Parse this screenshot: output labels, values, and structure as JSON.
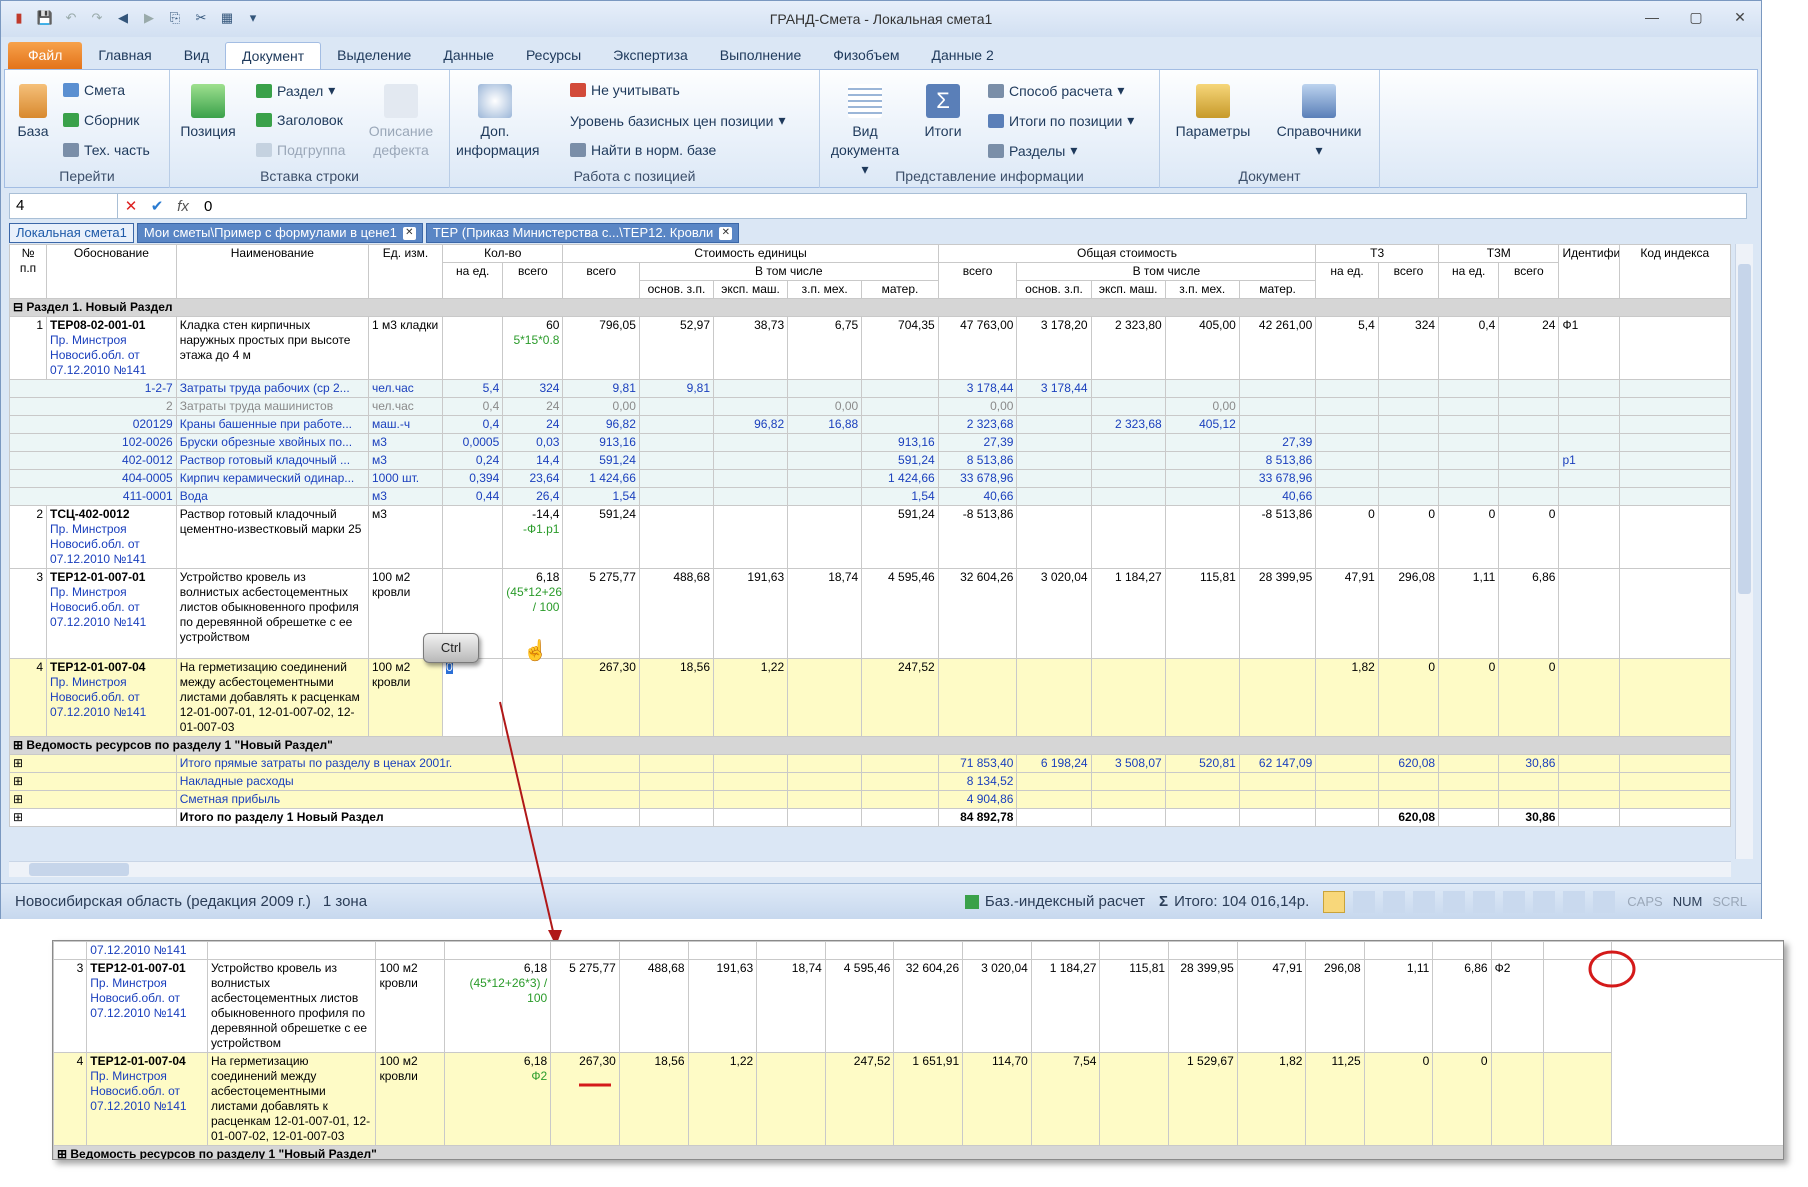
{
  "app": {
    "title": "ГРАНД-Смета - Локальная смета1"
  },
  "tabs": [
    "Файл",
    "Главная",
    "Вид",
    "Документ",
    "Выделение",
    "Данные",
    "Ресурсы",
    "Экспертиза",
    "Выполнение",
    "Физобъем",
    "Данные 2"
  ],
  "ribbon": {
    "base": "База",
    "smeta": "Смета",
    "sbornik": "Сборник",
    "tech": "Тех. часть",
    "g_go": "Перейти",
    "position": "Позиция",
    "razdel": "Раздел",
    "zagolovok": "Заголовок",
    "podgruppa": "Подгруппа",
    "opisanie": "Описание дефекта",
    "g_insert": "Вставка строки",
    "dop": "Доп. информация",
    "neuchit": "Не учитывать",
    "uroven": "Уровень базисных цен позиции",
    "naiti": "Найти в норм. базе",
    "g_work": "Работа с позицией",
    "vid": "Вид документа",
    "itogi": "Итоги",
    "sposob": "Способ расчета",
    "itogipos": "Итоги по позиции",
    "razdely": "Разделы",
    "g_pred": "Представление информации",
    "params": "Параметры",
    "sprav": "Справочники",
    "g_doc": "Документ"
  },
  "formula": {
    "cell": "4",
    "value": "0"
  },
  "doctabs": [
    "Локальная смета1",
    "Мои сметы\\Пример с формулами в цене1",
    "ТЕР (Приказ Министерства с...\\ТЕР12. Кровли"
  ],
  "headers": {
    "np": "№ п.п",
    "obosn": "Обоснование",
    "naim": "Наименование",
    "ed": "Ед. изм.",
    "kol": "Кол-во",
    "naed": "на ед.",
    "vsego": "всего",
    "stoim": "Стоимость единицы",
    "vtom": "В том числе",
    "osn": "основ. з.п.",
    "eksp": "эксп. маш.",
    "zpm": "з.п. мех.",
    "mat": "матер.",
    "obsh": "Общая стоимость",
    "tz": "Т3",
    "tzm": "Т3М",
    "ident": "Идентификатор",
    "kod": "Код индекса"
  },
  "section": "Раздел 1. Новый Раздел",
  "rows": [
    {
      "t": "pos",
      "np": "1",
      "code": "ТЕР08-02-001-01",
      "src": "Пр. Минстроя Новосиб.обл. от 07.12.2010 №141",
      "name": "Кладка стен кирпичных наружных простых при высоте этажа до 4 м",
      "ed": "1 м3 кладки",
      "naed": "",
      "vsego": "60",
      "formula": "5*15*0.8",
      "u1": "796,05",
      "u2": "52,97",
      "u3": "38,73",
      "u4": "6,75",
      "u5": "704,35",
      "o1": "47 763,00",
      "o2": "3 178,20",
      "o3": "2 323,80",
      "o4": "405,00",
      "o5": "42 261,00",
      "tz1": "5,4",
      "tz2": "324",
      "tzm1": "0,4",
      "tzm2": "24",
      "id": "Ф1"
    },
    {
      "t": "res",
      "np": "1-2-7",
      "name": "Затраты труда рабочих (ср 2...",
      "ed": "чел.час",
      "naed": "5,4",
      "vsego": "324",
      "u1": "9,81",
      "u2": "9,81",
      "o1": "3 178,44",
      "o2": "3 178,44"
    },
    {
      "t": "resg",
      "np": "2",
      "name": "Затраты труда машинистов",
      "ed": "чел.час",
      "naed": "0,4",
      "vsego": "24",
      "u1": "0,00",
      "u4": "0,00",
      "o1": "0,00",
      "o4": "0,00"
    },
    {
      "t": "res",
      "np": "020129",
      "name": "Краны башенные при работе...",
      "ed": "маш.-ч",
      "naed": "0,4",
      "vsego": "24",
      "u1": "96,82",
      "u3": "96,82",
      "u4": "16,88",
      "o1": "2 323,68",
      "o3": "2 323,68",
      "o4": "405,12"
    },
    {
      "t": "res",
      "np": "102-0026",
      "name": "Бруски обрезные хвойных по...",
      "ed": "м3",
      "naed": "0,0005",
      "vsego": "0,03",
      "u1": "913,16",
      "u5": "913,16",
      "o1": "27,39",
      "o5": "27,39"
    },
    {
      "t": "res",
      "np": "402-0012",
      "name": "Раствор готовый кладочный ...",
      "ed": "м3",
      "naed": "0,24",
      "vsego": "14,4",
      "u1": "591,24",
      "u5": "591,24",
      "o1": "8 513,86",
      "o5": "8 513,86",
      "id": "р1"
    },
    {
      "t": "res",
      "np": "404-0005",
      "name": "Кирпич керамический одинар...",
      "ed": "1000 шт.",
      "naed": "0,394",
      "vsego": "23,64",
      "u1": "1 424,66",
      "u5": "1 424,66",
      "o1": "33 678,96",
      "o5": "33 678,96"
    },
    {
      "t": "res",
      "np": "411-0001",
      "name": "Вода",
      "ed": "м3",
      "naed": "0,44",
      "vsego": "26,4",
      "u1": "1,54",
      "u5": "1,54",
      "o1": "40,66",
      "o5": "40,66"
    },
    {
      "t": "pos",
      "np": "2",
      "code": "ТСЦ-402-0012",
      "src": "Пр. Минстроя Новосиб.обл. от 07.12.2010 №141",
      "name": "Раствор готовый кладочный цементно-известковый марки 25",
      "ed": "м3",
      "naed": "",
      "vsego": "-14,4",
      "formula": "-Ф1.р1",
      "u1": "591,24",
      "u5": "591,24",
      "o1": "-8 513,86",
      "o5": "-8 513,86",
      "tz1": "0",
      "tz2": "0",
      "tzm1": "0",
      "tzm2": "0"
    },
    {
      "t": "pos",
      "np": "3",
      "code": "ТЕР12-01-007-01",
      "src": "Пр. Минстроя Новосиб.обл. от 07.12.2010 №141",
      "name": "Устройство кровель из волнистых асбестоцементных листов обыкновенного профиля по деревянной обрешетке с ее устройством",
      "ed": "100 м2 кровли",
      "naed": "",
      "vsego": "6,18",
      "formula": "(45*12+26*3) / 100",
      "u1": "5 275,77",
      "u2": "488,68",
      "u3": "191,63",
      "u4": "18,74",
      "u5": "4 595,46",
      "o1": "32 604,26",
      "o2": "3 020,04",
      "o3": "1 184,27",
      "o4": "115,81",
      "o5": "28 399,95",
      "tz1": "47,91",
      "tz2": "296,08",
      "tzm1": "1,11",
      "tzm2": "6,86"
    },
    {
      "t": "posy",
      "np": "4",
      "code": "ТЕР12-01-007-04",
      "src": "Пр. Минстроя Новосиб.обл. от 07.12.2010 №141",
      "name": "На герметизацию соединений между асбестоцементными листами добавлять к расценкам 12-01-007-01, 12-01-007-02, 12-01-007-03",
      "ed": "100 м2 кровли",
      "naed": "0",
      "vsego": "",
      "u1": "267,30",
      "u2": "18,56",
      "u3": "1,22",
      "u5": "247,52",
      "tz1": "1,82",
      "tz2": "0",
      "tzm1": "0",
      "tzm2": "0"
    }
  ],
  "vedomost": "Ведомость ресурсов по разделу 1 \"Новый Раздел\"",
  "totals": [
    {
      "name": "Итого прямые затраты по разделу в ценах 2001г.",
      "o1": "71 853,40",
      "o2": "6 198,24",
      "o3": "3 508,07",
      "o4": "520,81",
      "o5": "62 147,09",
      "tz2": "620,08",
      "tzm2": "30,86",
      "bold": false
    },
    {
      "name": "Накладные расходы",
      "o1": "8 134,52",
      "bold": false
    },
    {
      "name": "Сметная прибыль",
      "o1": "4 904,86",
      "bold": false
    },
    {
      "name": "Итого по разделу 1 Новый Раздел",
      "o1": "84 892,78",
      "tz2": "620,08",
      "tzm2": "30,86",
      "bold": true
    }
  ],
  "status": {
    "region": "Новосибирская область (редакция 2009 г.)",
    "zone": "1 зона",
    "calc": "Баз.-индексный расчет",
    "itog": "Итого: 104 016,14р.",
    "caps": "CAPS",
    "num": "NUM",
    "scrl": "SCRL"
  },
  "ctrl": "Ctrl",
  "zoom": {
    "top": "07.12.2010 №141",
    "r3": {
      "np": "3",
      "code": "ТЕР12-01-007-01",
      "src": "Пр. Минстроя Новосиб.обл. от 07.12.2010 №141",
      "name": "Устройство кровель из волнистых асбестоцементных листов обыкновенного профиля по деревянной обрешетке с ее устройством",
      "ed": "100 м2 кровли",
      "vsego": "6,18",
      "formula": "(45*12+26*3) / 100",
      "c": [
        "5 275,77",
        "488,68",
        "191,63",
        "18,74",
        "4 595,46",
        "32 604,26",
        "3 020,04",
        "1 184,27",
        "115,81",
        "28 399,95",
        "47,91",
        "296,08",
        "1,11",
        "6,86"
      ],
      "id": "Ф2"
    },
    "r4": {
      "np": "4",
      "code": "ТЕР12-01-007-04",
      "src": "Пр. Минстроя Новосиб.обл. от 07.12.2010 №141",
      "name": "На герметизацию соединений между асбестоцементными листами добавлять к расценкам 12-01-007-01, 12-01-007-02, 12-01-007-03",
      "ed": "100 м2 кровли",
      "vsego": "6,18",
      "formula": "Ф2",
      "c": [
        "267,30",
        "18,56",
        "1,22",
        "",
        "247,52",
        "1 651,91",
        "114,70",
        "7,54",
        "",
        "1 529,67",
        "1,82",
        "11,25",
        "0",
        "0"
      ]
    },
    "ved": "Ведомость ресурсов по разделу 1 \"Новый Раздел\""
  }
}
